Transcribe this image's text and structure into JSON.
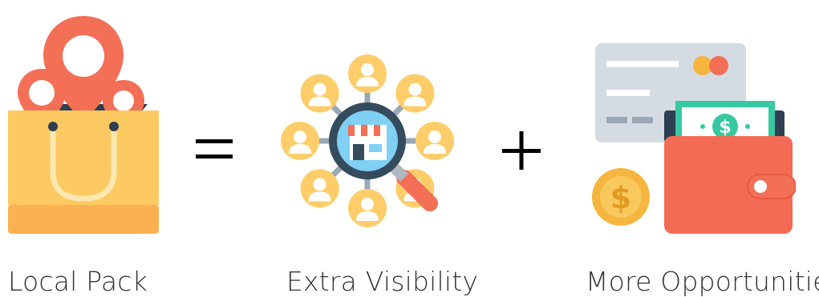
{
  "items": [
    {
      "label": "Local Pack",
      "icon": "shopping-bag-with-location-pins-icon"
    },
    {
      "label": "Extra Visibility",
      "icon": "store-magnifier-network-icon"
    },
    {
      "label": "More Opportunities",
      "icon": "wallet-card-coin-icon"
    }
  ],
  "operators": {
    "equals": "=",
    "plus": "+"
  },
  "colors": {
    "pin": "#f36f56",
    "bag": "#fdc963",
    "bag_bottom": "#fbb151",
    "person_bg": "#fdcd6a",
    "magnifier": "#354b5e",
    "card": "#d5dbe2",
    "wallet": "#f46b55",
    "cash": "#37c9a1",
    "coin": "#f5b53f"
  }
}
